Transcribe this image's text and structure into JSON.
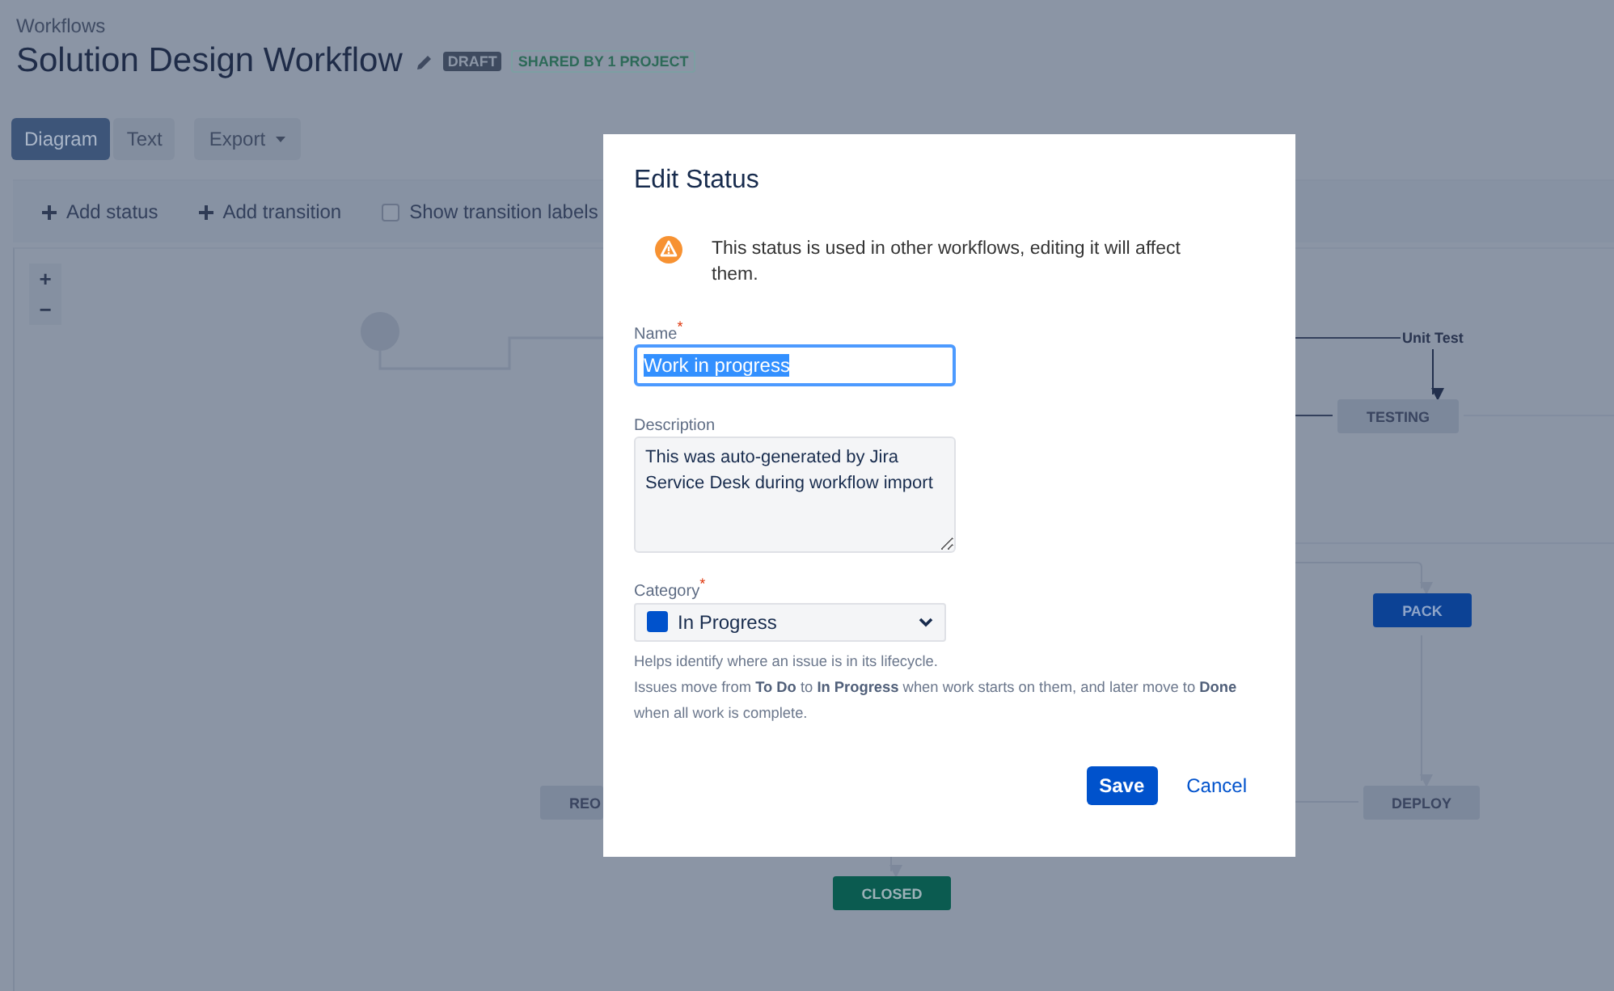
{
  "breadcrumb": "Workflows",
  "title": "Solution Design Workflow",
  "badges": [
    {
      "label": "DRAFT",
      "kind": "draft"
    },
    {
      "label": "SHARED BY 1 PROJECT",
      "kind": "shared"
    }
  ],
  "view_tabs": [
    {
      "label": "Diagram",
      "selected": true
    },
    {
      "label": "Text",
      "selected": false
    }
  ],
  "export_button": "Export",
  "toolbar": {
    "add_status": "Add status",
    "add_transition": "Add transition",
    "show_labels": {
      "label": "Show transition labels",
      "checked": false
    }
  },
  "zoom": [
    "+",
    "−"
  ],
  "diagram": {
    "nodes": [
      {
        "kind": "start"
      },
      {
        "label": "TESTING",
        "kind": "todo"
      },
      {
        "label": "PACK",
        "kind": "inprogress"
      },
      {
        "label": "REO",
        "kind": "todo"
      },
      {
        "label": "DEPLOY",
        "kind": "todo"
      },
      {
        "label": "CLOSED",
        "kind": "done"
      }
    ],
    "transition_labels": [
      "Unit Test"
    ]
  },
  "dialog": {
    "title": "Edit Status",
    "warning": "This status is used in other workflows, editing it will affect them.",
    "required_mark": "*",
    "name": {
      "label": "Name",
      "required": true,
      "value": "Work in progress",
      "selected": true
    },
    "description": {
      "label": "Description",
      "value": "This was auto-generated by Jira Service Desk during workflow import"
    },
    "category": {
      "label": "Category",
      "required": true,
      "value": "In Progress",
      "color": "#0052cc"
    },
    "help": [
      "Helps identify where an issue is in its lifecycle.",
      "Issues move from **To Do** to **In Progress** when work starts on them, and later move to **Done** when all work is complete."
    ],
    "save": "Save",
    "cancel": "Cancel"
  }
}
